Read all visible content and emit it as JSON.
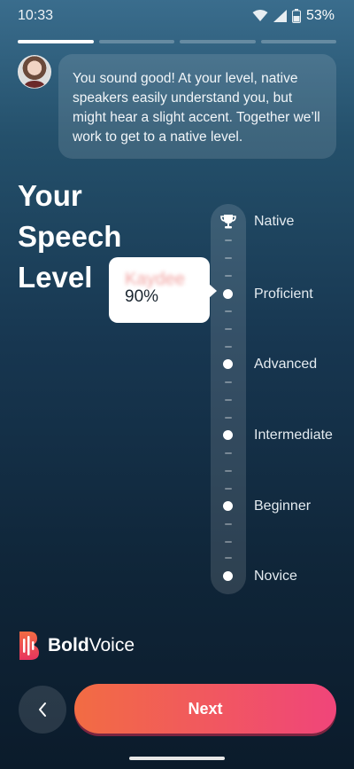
{
  "status_bar": {
    "time": "10:33",
    "battery": "53%"
  },
  "progress": {
    "current": 1,
    "total": 4
  },
  "coach": {
    "message": "You sound good! At your level, native speakers easily understand you, but might hear a slight accent. Together we’ll work to get to a native level."
  },
  "title": {
    "line1": "Your",
    "line2": "Speech",
    "line3": "Level"
  },
  "levels": [
    "Native",
    "Proficient",
    "Advanced",
    "Intermediate",
    "Beginner",
    "Novice"
  ],
  "result": {
    "name": "Kaydee",
    "percent": "90%",
    "level": "Proficient"
  },
  "brand": {
    "bold": "Bold",
    "regular": "Voice"
  },
  "buttons": {
    "next": "Next"
  },
  "colors": {
    "accent_start": "#f26c43",
    "accent_end": "#f0457a"
  }
}
